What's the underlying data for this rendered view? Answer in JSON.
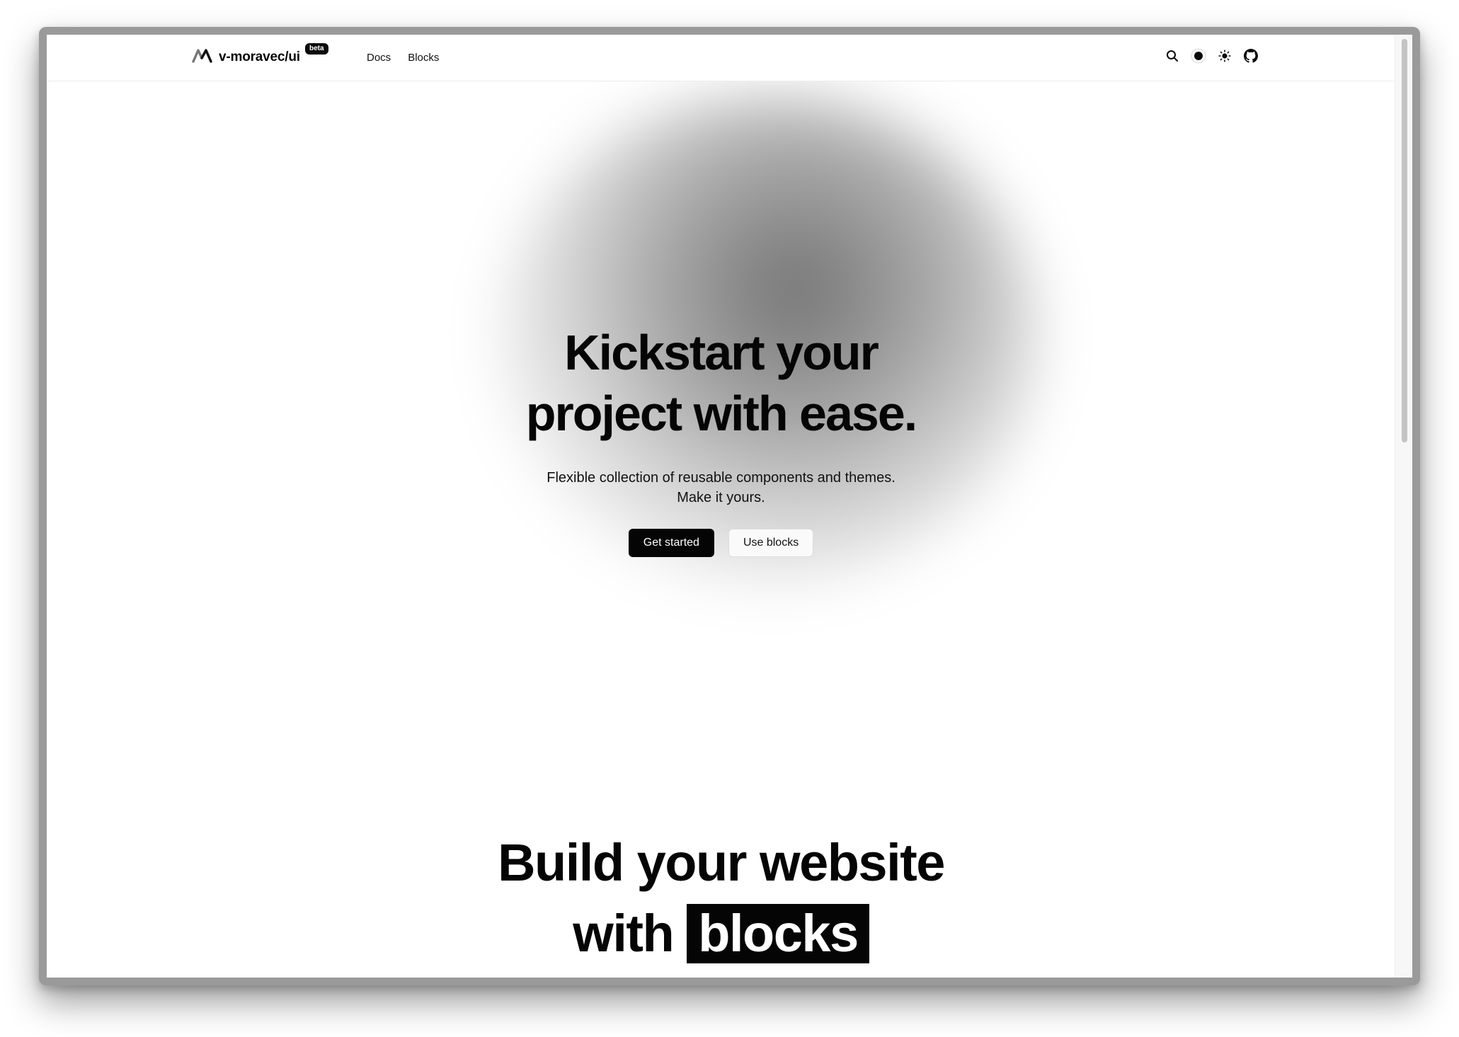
{
  "brand": {
    "name": "v-moravec/ui",
    "badge": "beta"
  },
  "nav": {
    "links": [
      {
        "label": "Docs"
      },
      {
        "label": "Blocks"
      }
    ]
  },
  "actions": [
    {
      "icon": "search-icon"
    },
    {
      "icon": "theme-dot-icon"
    },
    {
      "icon": "sun-icon"
    },
    {
      "icon": "github-icon"
    }
  ],
  "hero": {
    "title_line1": "Kickstart your",
    "title_line2": "project with ease.",
    "subtitle_line1": "Flexible collection of reusable components and themes.",
    "subtitle_line2": "Make it yours.",
    "primary_button": "Get started",
    "secondary_button": "Use blocks"
  },
  "blocks": {
    "title_line1": "Build your website",
    "title_line2_prefix": "with",
    "title_highlight": "blocks"
  },
  "colors": {
    "text": "#050505",
    "accent": "#050505",
    "background": "#ffffff"
  }
}
